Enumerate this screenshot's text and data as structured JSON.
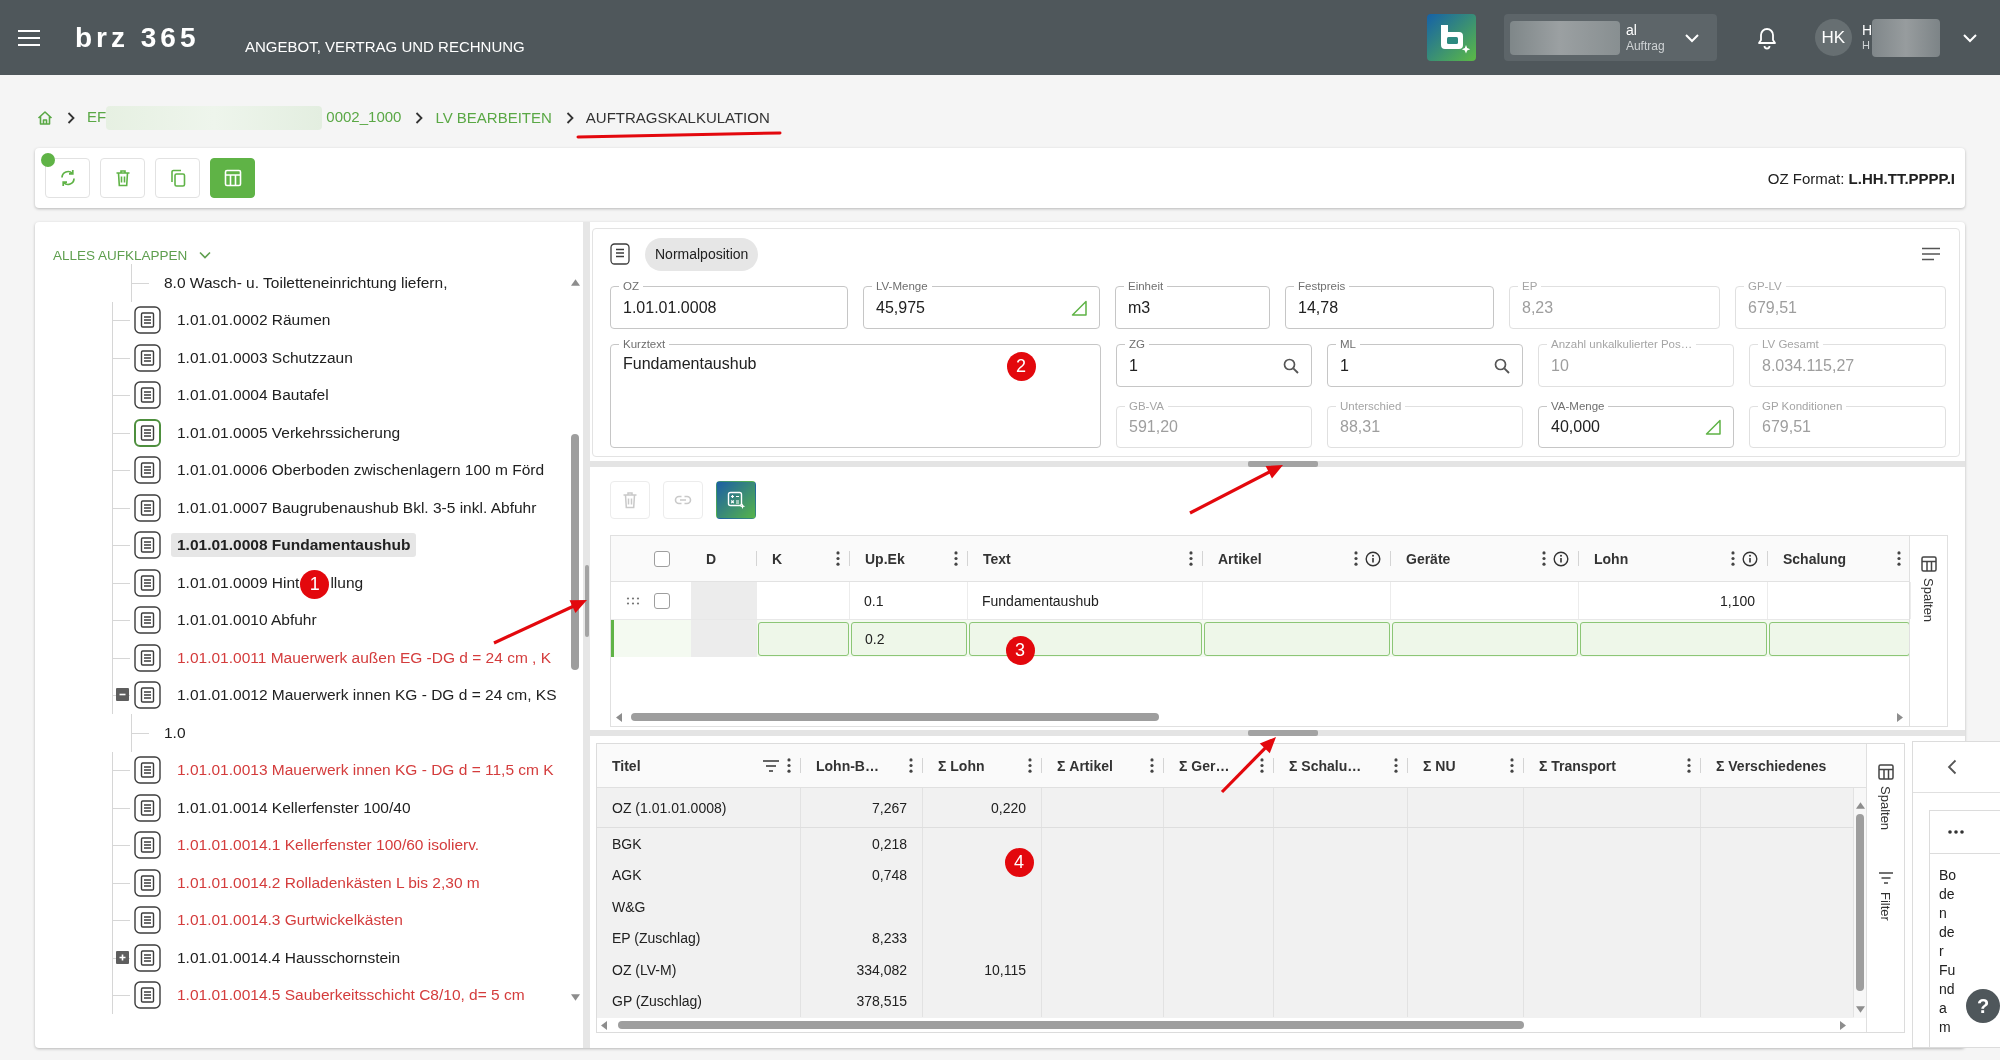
{
  "header": {
    "logo": "brz 365",
    "title": "ANGEBOT, VERTRAG UND RECHNUNG",
    "project": {
      "name": "al",
      "subtitle": "Auftrag"
    },
    "user": {
      "initials": "HK",
      "name": "H",
      "subtitle": "H"
    }
  },
  "breadcrumb": [
    {
      "label": "EF",
      "label_after_blur": "0002_1000",
      "current": false
    },
    {
      "label": "LV BEARBEITEN",
      "current": false
    },
    {
      "label": "AUFTRAGSKALKULATION",
      "current": true
    }
  ],
  "toolbar": {
    "buttons": [
      {
        "kind": "refresh",
        "on": false
      },
      {
        "kind": "delete",
        "on": false
      },
      {
        "kind": "copy",
        "on": false
      },
      {
        "kind": "table",
        "on": true
      }
    ],
    "oz_format": "OZ Format: **L.HH.TT.PPPP.I**"
  },
  "tree": {
    "expand_all": "ALLES AUFKLAPPEN",
    "items": [
      {
        "kind": "continuation",
        "children": [
          {
            "kind": "text",
            "label": "8.0 Wasch- u. Toiletteneinrichtung liefern,",
            "color": "#212121",
            "selected": false
          }
        ]
      },
      {
        "kind": "position",
        "label": "1.01.01.0002 Räumen",
        "color": "#212121",
        "selected": false,
        "focused": false
      },
      {
        "kind": "position",
        "label": "1.01.01.0003 Schutzzaun",
        "color": "#212121",
        "selected": false,
        "focused": false
      },
      {
        "kind": "position",
        "label": "1.01.01.0004 Bautafel",
        "color": "#212121",
        "selected": false,
        "focused": false
      },
      {
        "kind": "position",
        "label": "1.01.01.0005 Verkehrssicherung",
        "color": "#212121",
        "selected": false,
        "focused": true
      },
      {
        "kind": "position",
        "label": "1.01.01.0006 Oberboden zwischenlagern 100 m Förd",
        "color": "#212121",
        "selected": false,
        "focused": false
      },
      {
        "kind": "position",
        "label": "1.01.01.0007 Baugrubenaushub Bkl. 3-5 inkl. Abfuhr",
        "color": "#212121",
        "selected": false,
        "focused": false
      },
      {
        "kind": "position",
        "label": "1.01.01.0008 Fundamentaushub",
        "color": "#212121",
        "selected": true,
        "focused": false
      },
      {
        "kind": "position",
        "label": "1.01.01.0009 Hint",
        "annotation": "1",
        "label_tail": "llung",
        "color": "#212121",
        "selected": false,
        "focused": false
      },
      {
        "kind": "position",
        "label": "1.01.01.0010 Abfuhr",
        "color": "#212121",
        "selected": false,
        "focused": false
      },
      {
        "kind": "position",
        "label": "1.01.01.0011 Mauerwerk außen EG -DG d = 24 cm , K",
        "color": "#d43c3c",
        "selected": false,
        "focused": false
      },
      {
        "kind": "position",
        "label": "1.01.01.0012 Mauerwerk innen KG - DG d = 24 cm, KS",
        "color": "#212121",
        "selected": false,
        "focused": false,
        "expanded": true,
        "children": [
          {
            "kind": "text",
            "label": "1.0",
            "color": "#212121",
            "selected": false
          }
        ]
      },
      {
        "kind": "position",
        "label": "1.01.01.0013 Mauerwerk innen KG - DG d = 11,5 cm K",
        "color": "#d43c3c",
        "selected": false,
        "focused": false
      },
      {
        "kind": "position",
        "label": "1.01.01.0014 Kellerfenster 100/40",
        "color": "#212121",
        "selected": false,
        "focused": false
      },
      {
        "kind": "position",
        "label": "1.01.01.0014.1 Kellerfenster 100/60 isolierv.",
        "color": "#d43c3c",
        "selected": false,
        "focused": false
      },
      {
        "kind": "position",
        "label": "1.01.01.0014.2 Rolladenkästen L bis 2,30 m",
        "color": "#d43c3c",
        "selected": false,
        "focused": false
      },
      {
        "kind": "position",
        "label": "1.01.01.0014.3 Gurtwickelkästen",
        "color": "#d43c3c",
        "selected": false,
        "focused": false
      },
      {
        "kind": "position",
        "label": "1.01.01.0014.4 Hausschornstein",
        "color": "#212121",
        "selected": false,
        "focused": false,
        "expanded": false
      },
      {
        "kind": "position",
        "label": "1.01.01.0014.5 Sauberkeitsschicht C8/10, d= 5 cm",
        "color": "#d43c3c",
        "selected": false,
        "focused": false
      }
    ]
  },
  "position": {
    "type": "Normalposition",
    "fields_top": [
      {
        "label": "OZ",
        "value": "1.01.01.0008",
        "kind": "plain",
        "disabled": false
      },
      {
        "label": "LV-Menge",
        "value": "45,975",
        "kind": "quantity",
        "disabled": false
      },
      {
        "label": "Einheit",
        "value": "m3",
        "kind": "plain",
        "disabled": false
      },
      {
        "label": "Festpreis",
        "value": "14,78",
        "kind": "plain",
        "disabled": false
      },
      {
        "label": "EP",
        "value": "8,23",
        "kind": "plain",
        "disabled": true
      },
      {
        "label": "GP-LV",
        "value": "679,51",
        "kind": "plain",
        "disabled": true
      }
    ],
    "fields_grid": [
      {
        "label": "Kurztext",
        "value": "Fundamentaushub",
        "kind": "multiline",
        "disabled": false
      },
      {
        "label": "ZG",
        "value": "1",
        "kind": "lookup",
        "disabled": false
      },
      {
        "label": "ML",
        "value": "1",
        "kind": "lookup",
        "disabled": false
      },
      {
        "label": "Anzahl unkalkulierter Pos…",
        "value": "10",
        "kind": "plain",
        "disabled": true
      },
      {
        "label": "LV Gesamt",
        "value": "8.034.115,27",
        "kind": "plain",
        "disabled": true
      },
      {
        "label": "GB-VA",
        "value": "591,20",
        "kind": "plain",
        "disabled": true
      },
      {
        "label": "Unterschied",
        "value": "88,31",
        "kind": "plain",
        "disabled": true
      },
      {
        "label": "VA-Menge",
        "value": "40,000",
        "kind": "quantity",
        "disabled": false
      },
      {
        "label": "GP Konditionen",
        "value": "679,51",
        "kind": "plain",
        "disabled": true
      }
    ]
  },
  "positions_grid": {
    "tools": [
      {
        "kind": "delete",
        "disabled": true
      },
      {
        "kind": "link",
        "disabled": true
      },
      {
        "kind": "calculate",
        "disabled": false
      }
    ],
    "select_all_checked": false,
    "columns": [
      {
        "label": "D",
        "menu": false,
        "info": false
      },
      {
        "label": "K",
        "menu": true,
        "info": false
      },
      {
        "label": "Up.Ek",
        "menu": true,
        "info": false
      },
      {
        "label": "Text",
        "menu": true,
        "info": false
      },
      {
        "label": "Artikel",
        "menu": true,
        "info": true
      },
      {
        "label": "Geräte",
        "menu": true,
        "info": true
      },
      {
        "label": "Lohn",
        "menu": true,
        "info": true
      },
      {
        "label": "Schalung",
        "menu": true,
        "info": false
      }
    ],
    "rows": [
      {
        "editing": false,
        "checked": false,
        "cells": {
          "up_ek": "0.1",
          "text": "Fundamentaushub",
          "lohn": "1,100"
        }
      },
      {
        "editing": true,
        "cells": {
          "up_ek": "0.2"
        }
      }
    ],
    "side_tab": "Spalten"
  },
  "summary_grid": {
    "columns": [
      {
        "label": "Titel",
        "filter": true,
        "menu": true
      },
      {
        "label": "Lohn-B…",
        "filter": false,
        "menu": true
      },
      {
        "label": "Σ Lohn",
        "filter": false,
        "menu": true
      },
      {
        "label": "Σ Artikel",
        "filter": false,
        "menu": true
      },
      {
        "label": "Σ Ger…",
        "filter": false,
        "menu": true
      },
      {
        "label": "Σ Schalu…",
        "filter": false,
        "menu": true
      },
      {
        "label": "Σ NU",
        "filter": false,
        "menu": true
      },
      {
        "label": "Σ Transport",
        "filter": false,
        "menu": true
      },
      {
        "label": "Σ Verschiedenes",
        "filter": false,
        "menu": false
      }
    ],
    "rows": [
      {
        "title": "OZ (1.01.01.0008)",
        "values": [
          "7,267",
          "0,220"
        ]
      },
      {
        "title": "BGK",
        "values": [
          "0,218"
        ]
      },
      {
        "title": "AGK",
        "values": [
          "0,748"
        ]
      },
      {
        "title": "W&G"
      },
      {
        "title": "EP (Zuschlag)",
        "values": [
          "8,233"
        ]
      },
      {
        "title": "OZ (LV-M)",
        "values": [
          "334,082",
          "10,115"
        ]
      },
      {
        "title": "GP (Zuschlag)",
        "values": [
          "378,515"
        ]
      }
    ],
    "side_tabs": [
      {
        "kind": "columns",
        "label": "Spalten"
      },
      {
        "kind": "filter",
        "label": "Filter"
      }
    ]
  },
  "detail_panel": {
    "text": "Boden der Fundam"
  },
  "help": "?",
  "annotations": {
    "markers": [
      {
        "label": "2"
      },
      {
        "label": "3"
      },
      {
        "label": "4"
      }
    ]
  }
}
